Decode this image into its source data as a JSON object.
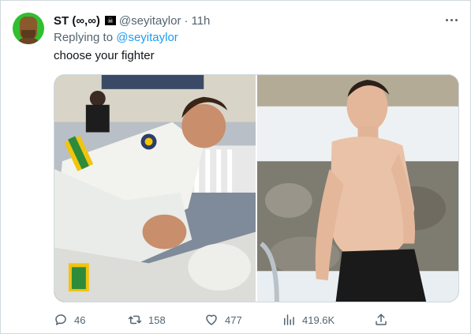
{
  "tweet": {
    "author_name": "ST (∞,∞)",
    "flag_glyph": "☠",
    "handle": "@seyitaylor",
    "separator": "·",
    "time": "11h",
    "replying_prefix": "Replying to",
    "replying_handle": "@seyitaylor",
    "text": "choose your fighter"
  },
  "actions": {
    "replies": "46",
    "retweets": "158",
    "likes": "477",
    "views": "419.6K"
  },
  "icons": {
    "more": "more-horizontal-icon",
    "reply": "reply-icon",
    "retweet": "retweet-icon",
    "like": "heart-icon",
    "views": "views-icon",
    "share": "share-icon"
  },
  "colors": {
    "link": "#1d9bf0",
    "secondary_text": "#536471",
    "primary_text": "#0f1419",
    "avatar_bg": "#2fbf2f"
  }
}
